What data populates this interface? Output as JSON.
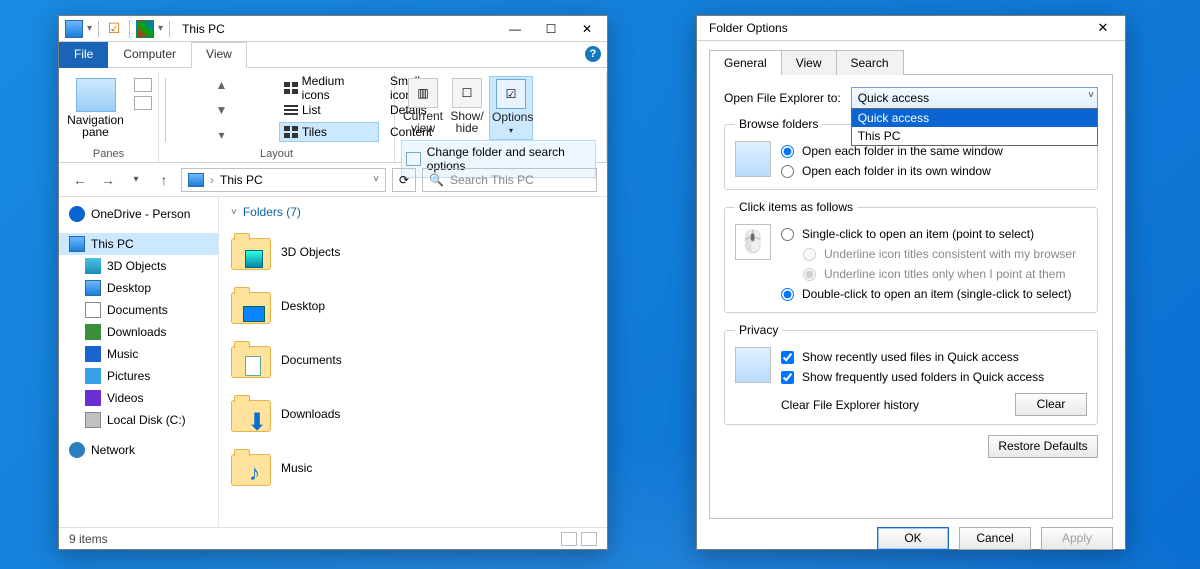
{
  "explorer": {
    "title": "This PC",
    "tabs": {
      "file": "File",
      "computer": "Computer",
      "view": "View"
    },
    "ribbon": {
      "navpane_label": "Navigation\npane",
      "group_panes": "Panes",
      "layout": {
        "medium": "Medium icons",
        "small": "Small icons",
        "list": "List",
        "details": "Details",
        "tiles": "Tiles",
        "content": "Content"
      },
      "group_layout": "Layout",
      "current_view": "Current\nview",
      "show_hide": "Show/\nhide",
      "options": "Options",
      "options_sub": "Change folder and search options"
    },
    "address": {
      "location": "This PC",
      "search_placeholder": "Search This PC"
    },
    "nav": {
      "onedrive": "OneDrive - Person",
      "this_pc": "This PC",
      "items": [
        "3D Objects",
        "Desktop",
        "Documents",
        "Downloads",
        "Music",
        "Pictures",
        "Videos",
        "Local Disk (C:)"
      ],
      "network": "Network"
    },
    "main": {
      "section": "Folders (7)",
      "tiles": [
        "3D Objects",
        "Desktop",
        "Documents",
        "Downloads",
        "Music"
      ]
    },
    "status": "9 items"
  },
  "dialog": {
    "title": "Folder Options",
    "tabs": [
      "General",
      "View",
      "Search"
    ],
    "open_to_label": "Open File Explorer to:",
    "combo_selected": "Quick access",
    "combo_options": [
      "Quick access",
      "This PC"
    ],
    "browse": {
      "legend": "Browse folders",
      "same": "Open each folder in the same window",
      "own": "Open each folder in its own window"
    },
    "click": {
      "legend": "Click items as follows",
      "single": "Single-click to open an item (point to select)",
      "u_browser": "Underline icon titles consistent with my browser",
      "u_point": "Underline icon titles only when I point at them",
      "double": "Double-click to open an item (single-click to select)"
    },
    "privacy": {
      "legend": "Privacy",
      "recent": "Show recently used files in Quick access",
      "frequent": "Show frequently used folders in Quick access",
      "clear_label": "Clear File Explorer history",
      "clear_btn": "Clear"
    },
    "restore": "Restore Defaults",
    "ok": "OK",
    "cancel": "Cancel",
    "apply": "Apply"
  }
}
